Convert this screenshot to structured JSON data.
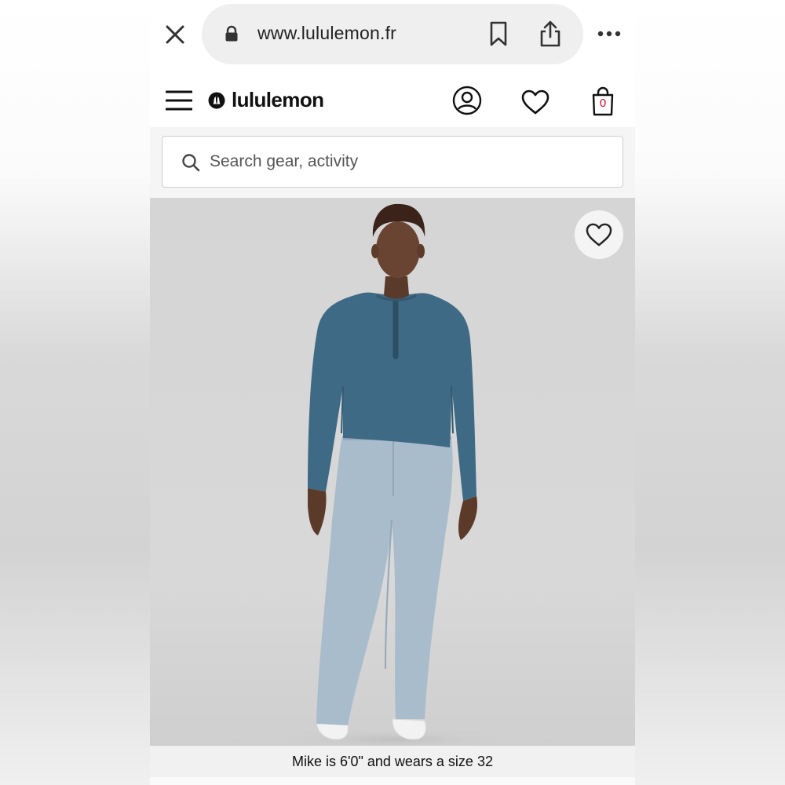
{
  "browser": {
    "url": "www.lululemon.fr"
  },
  "header": {
    "logo_text": "lululemon",
    "bag_count": "0"
  },
  "search": {
    "placeholder": "Search gear, activity"
  },
  "product": {
    "caption": "Mike is 6'0\" and wears a size 32"
  },
  "icons": {
    "close": "close-icon",
    "lock": "lock-icon",
    "bookmark": "bookmark-icon",
    "share": "share-icon",
    "more": "more-icon",
    "menu": "hamburger-menu-icon",
    "logo": "lululemon-logo-icon",
    "account": "account-icon",
    "wishlist": "heart-icon",
    "bag": "shopping-bag-icon",
    "search": "search-icon",
    "favorite": "heart-icon"
  },
  "colors": {
    "bag_count": "#c8102e",
    "shirt": "#3f6a86",
    "pants": "#a9bccb",
    "image_background": "#d6d6d6"
  }
}
